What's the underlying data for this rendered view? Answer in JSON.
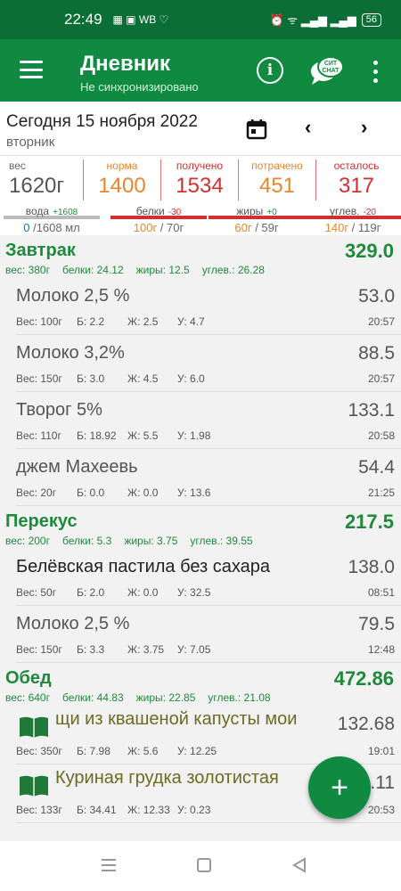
{
  "statusbar": {
    "time": "22:49",
    "icons_text": "▦ ▣ WB ♡",
    "right_icons": "⏰ ᯤ ▂▄▆ ▂▄▆",
    "battery": "56"
  },
  "appbar": {
    "title": "Дневник",
    "subtitle": "Не синхронизировано",
    "info_label": "i",
    "chat_label": "СИТ CHAT"
  },
  "datebar": {
    "date": "Сегодня 15 ноября 2022",
    "weekday": "вторник",
    "prev": "‹",
    "next": "›"
  },
  "summary": {
    "weight": {
      "label": "вес",
      "value": "1620г"
    },
    "norm": {
      "label": "норма",
      "value": "1400"
    },
    "received": {
      "label": "получено",
      "value": "1534"
    },
    "spent": {
      "label": "потрачено",
      "value": "451"
    },
    "left": {
      "label": "осталось",
      "value": "317"
    },
    "macros": [
      {
        "label": "вода",
        "delta": "+1608",
        "value_a": "0",
        "value_b": " /1608 мл"
      },
      {
        "label": "белки",
        "delta": "-30",
        "value_a": "100г",
        "value_b": " / 70г"
      },
      {
        "label": "жиры",
        "delta": "+0",
        "value_a": "60г",
        "value_b": " / 59г"
      },
      {
        "label": "углев.",
        "delta": "-20",
        "value_a": "140г",
        "value_b": " / 119г"
      }
    ]
  },
  "meals": [
    {
      "name": "Завтрак",
      "total": "329.0",
      "meta": [
        "вес: 380г",
        "белки: 24.12",
        "жиры: 12.5",
        "углев.: 26.28"
      ],
      "items": [
        {
          "name": "Молоко 2,5 %",
          "cal": "53.0",
          "w": "Вес: 100г",
          "p": "Б: 2.2",
          "f": "Ж: 2.5",
          "c": "У: 4.7",
          "time": "20:57"
        },
        {
          "name": "Молоко 3,2%",
          "cal": "88.5",
          "w": "Вес: 150г",
          "p": "Б: 3.0",
          "f": "Ж: 4.5",
          "c": "У: 6.0",
          "time": "20:57"
        },
        {
          "name": "Творог 5%",
          "cal": "133.1",
          "w": "Вес: 110г",
          "p": "Б: 18.92",
          "f": "Ж: 5.5",
          "c": "У: 1.98",
          "time": "20:58"
        },
        {
          "name": "джем Махеевь",
          "cal": "54.4",
          "w": "Вес: 20г",
          "p": "Б: 0.0",
          "f": "Ж: 0.0",
          "c": "У: 13.6",
          "time": "21:25"
        }
      ]
    },
    {
      "name": "Перекус",
      "total": "217.5",
      "meta": [
        "вес: 200г",
        "белки: 5.3",
        "жиры: 3.75",
        "углев.: 39.55"
      ],
      "items": [
        {
          "name": "Белёвская пастила без сахара",
          "cal": "138.0",
          "w": "Вес: 50г",
          "p": "Б: 2.0",
          "f": "Ж: 0.0",
          "c": "У: 32.5",
          "time": "08:51"
        },
        {
          "name": "Молоко 2,5 %",
          "cal": "79.5",
          "w": "Вес: 150г",
          "p": "Б: 3.3",
          "f": "Ж: 3.75",
          "c": "У: 7.05",
          "time": "12:48"
        }
      ]
    },
    {
      "name": "Обед",
      "total": "472.86",
      "meta": [
        "вес: 640г",
        "белки: 44.83",
        "жиры: 22.85",
        "углев.: 21.08"
      ],
      "items": [
        {
          "name": "щи из квашеной капусты мои",
          "cal": "132.68",
          "w": "Вес: 350г",
          "p": "Б: 7.98",
          "f": "Ж: 5.6",
          "c": "У: 12.25",
          "time": "19:01"
        },
        {
          "name": "Куриная грудка золотистая",
          "cal": "...11",
          "w": "Вес: 133г",
          "p": "Б: 34.41",
          "f": "Ж: 12.33",
          "c": "У: 0.23",
          "time": "20:53"
        }
      ]
    }
  ],
  "fab": {
    "label": "+"
  },
  "colors": {
    "primary": "#0f8a40",
    "statusbar": "#0b6e35",
    "orange": "#e8862e",
    "red": "#d32f2f",
    "green": "#1e8a3c",
    "olive": "#6b6b22"
  }
}
